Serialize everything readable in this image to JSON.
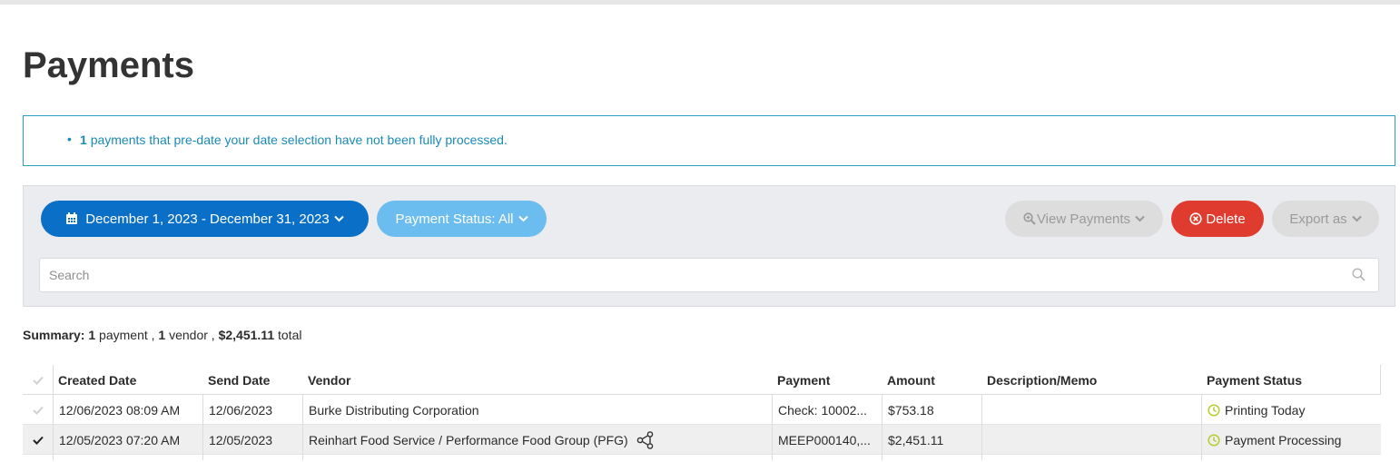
{
  "page": {
    "title": "Payments"
  },
  "notice": {
    "count": "1",
    "text": "payments that pre-date your date selection have not been fully processed."
  },
  "toolbar": {
    "date_range": "December 1, 2023 - December 31, 2023",
    "payment_status": "Payment Status: All",
    "view_payments": "View Payments",
    "delete": "Delete",
    "export": "Export as",
    "search_placeholder": "Search"
  },
  "summary": {
    "label": "Summary:",
    "payments_count": "1",
    "payments_word": "payment ,",
    "vendors_count": "1",
    "vendors_word": "vendor ,",
    "total": "$2,451.11",
    "total_word": "total"
  },
  "table": {
    "headers": [
      "Created Date",
      "Send Date",
      "Vendor",
      "Payment",
      "Amount",
      "Description/Memo",
      "Payment Status"
    ],
    "rows": [
      {
        "created": "12/06/2023 08:09 AM",
        "send": "12/06/2023",
        "vendor": "Burke Distributing Corporation",
        "payment": "Check: 10002...",
        "amount": "$753.18",
        "memo": "",
        "status": "Printing Today",
        "selected": false
      },
      {
        "created": "12/05/2023 07:20 AM",
        "send": "12/05/2023",
        "vendor": "Reinhart Food Service / Performance Food Group (PFG)",
        "payment": "MEEP000140,...",
        "amount": "$2,451.11",
        "memo": "",
        "status": "Payment Processing",
        "selected": true
      }
    ]
  },
  "colors": {
    "primary": "#0a70c7",
    "secondary": "#6bbcef",
    "danger": "#e03b2f",
    "notice": "#1a8ab5",
    "status_clock": "#b6cc2e"
  }
}
